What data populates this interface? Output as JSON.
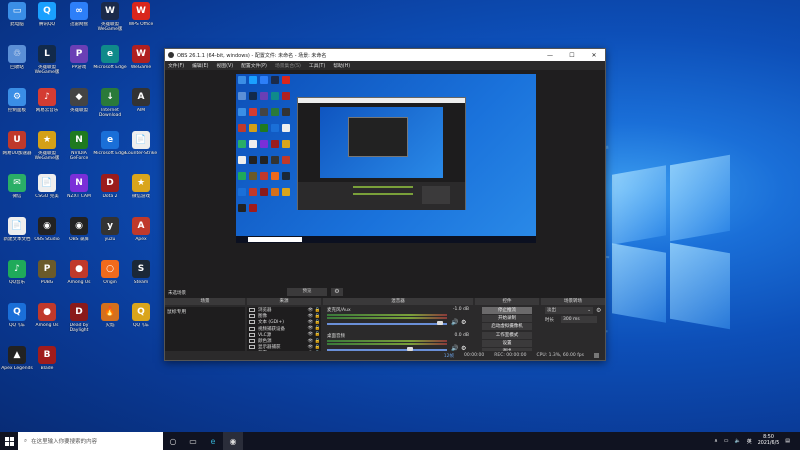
{
  "desktop": {
    "icons": [
      {
        "label": "此电脑",
        "color": "#3a8ee6",
        "glyph": "▭"
      },
      {
        "label": "腾讯QQ",
        "color": "#1aa0ff",
        "glyph": "Q"
      },
      {
        "label": "迅雷网盘",
        "color": "#2d7ff9",
        "glyph": "∞"
      },
      {
        "label": "英雄联盟WeGame版",
        "color": "#1b2a4a",
        "glyph": "W"
      },
      {
        "label": "WPS Office",
        "color": "#d9261c",
        "glyph": "W"
      },
      {
        "label": "回收站",
        "color": "#5b8fd6",
        "glyph": "♲"
      },
      {
        "label": "英雄联盟WeGame版",
        "color": "#122a4a",
        "glyph": "L"
      },
      {
        "label": "PP游戏",
        "color": "#6a3fb5",
        "glyph": "P"
      },
      {
        "label": "Microsoft Edge",
        "color": "#0f8a8a",
        "glyph": "e"
      },
      {
        "label": "WeGame",
        "color": "#b02020",
        "glyph": "W"
      },
      {
        "label": "控制面板",
        "color": "#3a8ee6",
        "glyph": "⚙"
      },
      {
        "label": "网易云音乐",
        "color": "#d43c33",
        "glyph": "♪"
      },
      {
        "label": "英雄联盟",
        "color": "#444",
        "glyph": "◆"
      },
      {
        "label": "Internet Download",
        "color": "#2a7a3a",
        "glyph": "↓"
      },
      {
        "label": "AIM",
        "color": "#333",
        "glyph": "A"
      },
      {
        "label": "网易UU加速器",
        "color": "#c0392b",
        "glyph": "U"
      },
      {
        "label": "英雄联盟WeGame版",
        "color": "#d4a017",
        "glyph": "★"
      },
      {
        "label": "NVIDIA GeForce",
        "color": "#1f7a1f",
        "glyph": "N"
      },
      {
        "label": "Microsoft Edge",
        "color": "#1a6fd8",
        "glyph": "e"
      },
      {
        "label": "Counter-Strike",
        "color": "#eee",
        "glyph": "📄"
      },
      {
        "label": "微信",
        "color": "#2aae67",
        "glyph": "✉"
      },
      {
        "label": "CSGO 完美",
        "color": "#eee",
        "glyph": "📄"
      },
      {
        "label": "NZXT CAM",
        "color": "#7a2fd8",
        "glyph": "N"
      },
      {
        "label": "Dota 2",
        "color": "#9b1c1c",
        "glyph": "D"
      },
      {
        "label": "微信游戏",
        "color": "#d9a51c",
        "glyph": "★"
      },
      {
        "label": "新建文本文档",
        "color": "#eee",
        "glyph": "📄"
      },
      {
        "label": "OBS Studio",
        "color": "#222",
        "glyph": "◉"
      },
      {
        "label": "OBS 录屏",
        "color": "#222",
        "glyph": "◉"
      },
      {
        "label": "yuzu",
        "color": "#333",
        "glyph": "y"
      },
      {
        "label": "Apex",
        "color": "#c0392b",
        "glyph": "A"
      },
      {
        "label": "QQ音乐",
        "color": "#1faa5a",
        "glyph": "♪"
      },
      {
        "label": "PUBG",
        "color": "#6a5a2a",
        "glyph": "P"
      },
      {
        "label": "Among Us",
        "color": "#c0392b",
        "glyph": "●"
      },
      {
        "label": "Origin",
        "color": "#f06a1c",
        "glyph": "○"
      },
      {
        "label": "Steam",
        "color": "#1b2838",
        "glyph": "S"
      },
      {
        "label": "QQ飞车",
        "color": "#1a6fd8",
        "glyph": "Q"
      },
      {
        "label": "Among Us",
        "color": "#c0392b",
        "glyph": "●"
      },
      {
        "label": "Dead by Daylight",
        "color": "#8a1a1a",
        "glyph": "D"
      },
      {
        "label": "火焰",
        "color": "#d4701c",
        "glyph": "🔥"
      },
      {
        "label": "QQ飞车",
        "color": "#d9a51c",
        "glyph": "Q"
      },
      {
        "label": "Apex Legends",
        "color": "#222",
        "glyph": "▲"
      },
      {
        "label": "Blade",
        "color": "#a01c1c",
        "glyph": "B"
      }
    ]
  },
  "obs": {
    "title": "OBS 26.1.1 (64-bit, windows) - 配置文件: 未命名 - 场景: 未命名",
    "menu": [
      "文件(F)",
      "编辑(E)",
      "视图(V)",
      "配置文件(P)",
      "场景集合(S)",
      "工具(T)",
      "帮助(H)"
    ],
    "docks": {
      "scene_label": "未选场景",
      "preview_label": "预览",
      "scenes_header": "场景",
      "sources_header": "来源",
      "mixer_header": "混音器",
      "controls_header": "控件",
      "transitions_header": "场景转场",
      "scenes": [
        "鼠标专用"
      ],
      "sources": [
        "浏览器",
        "图像",
        "文本 (GDI+)",
        "视频捕获设备",
        "VLC源",
        "颜色源",
        "显示器捕获",
        "幕布"
      ],
      "mixer": [
        {
          "name": "麦克风/Aux",
          "db": "-1.0 dB"
        },
        {
          "name": "桌面音频",
          "db": "0.0 dB"
        }
      ],
      "controls": [
        "停止推流",
        "开始录制",
        "启动虚拟摄像机",
        "工作室模式",
        "设置",
        "退出"
      ],
      "transition_type": "淡出",
      "duration_label": "时长",
      "duration_value": "300 ms"
    },
    "status": {
      "dropped": "12帧",
      "live": "00:00:00",
      "rec": "REC: 00:00:00",
      "cpu": "CPU: 1.3%, 60.00 fps"
    }
  },
  "taskbar": {
    "search_placeholder": "在这里输入你要搜索的内容",
    "time": "8:50",
    "date": "2021/6/5"
  }
}
